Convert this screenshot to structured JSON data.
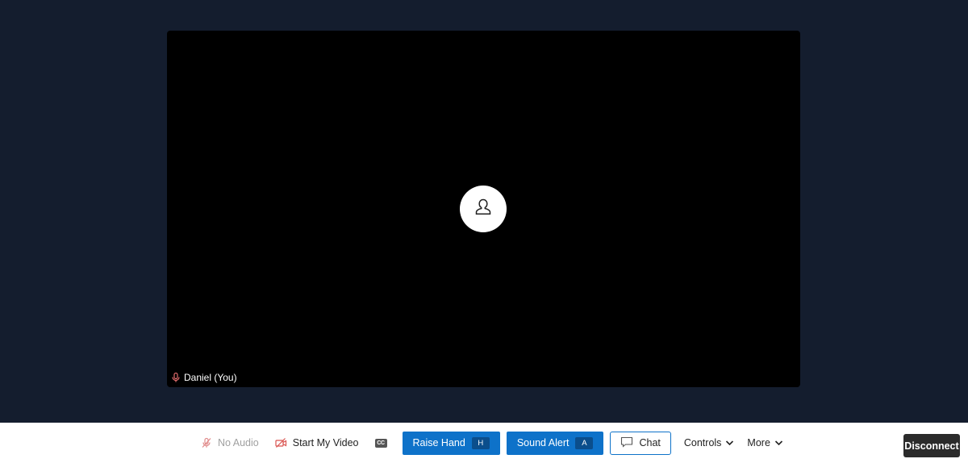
{
  "video": {
    "participant_name": "Daniel (You)",
    "avatar_icon": "person-icon",
    "mic_state_icon": "mic-muted-icon"
  },
  "toolbar": {
    "no_audio_label": "No Audio",
    "start_video_label": "Start My Video",
    "cc_label": "CC",
    "raise_hand_label": "Raise Hand",
    "raise_hand_key": "H",
    "sound_alert_label": "Sound Alert",
    "sound_alert_key": "A",
    "chat_label": "Chat",
    "controls_label": "Controls",
    "more_label": "More",
    "disconnect_label": "Disconnect"
  },
  "colors": {
    "background": "#141d2e",
    "primary": "#0e72c9",
    "disconnect": "#2b2b2b",
    "muted_red": "#d9534f"
  }
}
